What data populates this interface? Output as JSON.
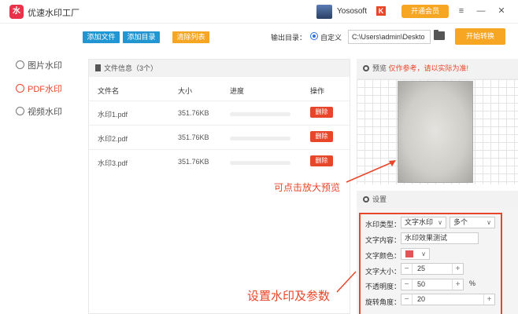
{
  "app": {
    "title": "优速水印工厂",
    "logo": "水",
    "username": "Yososoft",
    "badge": "K",
    "vip_label": "开通会员"
  },
  "window_controls": {
    "menu": "≡",
    "minimize": "—",
    "close": "✕"
  },
  "sidebar": {
    "items": [
      {
        "label": "图片水印",
        "active": false
      },
      {
        "label": "PDF水印",
        "active": true
      },
      {
        "label": "视频水印",
        "active": false
      }
    ]
  },
  "toolbar": {
    "add_file": "添加文件",
    "add_folder": "添加目录",
    "clear_list": "清除列表",
    "output_label": "输出目录：",
    "custom_label": "自定义",
    "output_path": "C:\\Users\\admin\\Deskto",
    "start_label": "开始转换"
  },
  "file_panel": {
    "header": "文件信息（3个）",
    "columns": [
      "文件名",
      "大小",
      "进度",
      "操作"
    ],
    "rows": [
      {
        "name": "水印1.pdf",
        "size": "351.76KB",
        "progress": 0,
        "action": "删除"
      },
      {
        "name": "水印2.pdf",
        "size": "351.76KB",
        "progress": 0,
        "action": "删除"
      },
      {
        "name": "水印3.pdf",
        "size": "351.76KB",
        "progress": 0,
        "action": "删除"
      }
    ]
  },
  "preview": {
    "title": "预览",
    "note": "仅作参考，请以实际为准!"
  },
  "annotations": {
    "click_preview": "可点击放大预览",
    "set_params": "设置水印及参数"
  },
  "settings": {
    "title": "设置",
    "type_label": "水印类型：",
    "type_value": "文字水印",
    "multi_value": "多个",
    "content_label": "文字内容：",
    "content_value": "水印效果测试",
    "color_label": "文字颜色：",
    "color_value": "#e05656",
    "size_label": "文字大小：",
    "size_value": "25",
    "opacity_label": "不透明度：",
    "opacity_value": "50",
    "opacity_unit": "%",
    "rotate_label": "旋转角度：",
    "rotate_value": "20",
    "minus": "−",
    "plus": "+",
    "arrow": "∨"
  },
  "colors": {
    "accent": "#e8462a",
    "blue": "#2196d3",
    "orange": "#f7a623",
    "red": "#e8334a"
  }
}
